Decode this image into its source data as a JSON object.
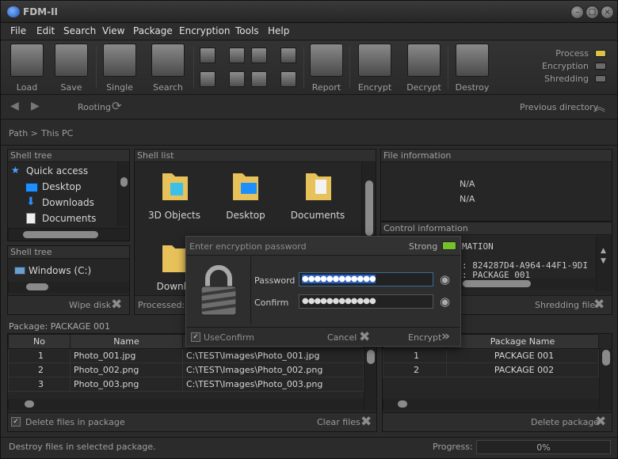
{
  "window": {
    "title": "FDM-II"
  },
  "menu": [
    "File",
    "Edit",
    "Search",
    "View",
    "Package",
    "Encryption",
    "Tools",
    "Help"
  ],
  "toolbar": {
    "buttons": [
      "Load",
      "Save",
      "Single",
      "Search",
      "Report",
      "Encrypt",
      "Decrypt",
      "Destroy"
    ],
    "indicators": [
      {
        "label": "Process",
        "color": "#d9c34a"
      },
      {
        "label": "Encryption",
        "color": "#6a6a6a"
      },
      {
        "label": "Shredding",
        "color": "#6a6a6a"
      }
    ]
  },
  "nav": {
    "rooting": "Rooting",
    "previous": "Previous directory"
  },
  "path": {
    "label": "Path >",
    "value": "This PC"
  },
  "shell_tree": {
    "header": "Shell tree",
    "items": [
      "Quick access",
      "Desktop",
      "Downloads",
      "Documents"
    ]
  },
  "drive_tree": {
    "header": "Shell tree",
    "items": [
      "Windows (C:)"
    ],
    "footer": "Wipe disk"
  },
  "shell_list": {
    "header": "Shell list",
    "items": [
      "3D Objects",
      "Desktop",
      "Documents",
      "Downlo"
    ],
    "footer": "Processed: 0"
  },
  "file_info": {
    "header": "File information",
    "lines": [
      "N/A",
      "N/A"
    ]
  },
  "control_info": {
    "header": "Control information",
    "lines": [
      "MATION",
      ": 824287D4-A964-44F1-9DI",
      ": PACKAGE 001"
    ],
    "footer": "Shredding file"
  },
  "dialog": {
    "title": "Enter encryption password",
    "strength": "Strong",
    "password_label": "Password",
    "password_value": "●●●●●●●●●●●●",
    "confirm_label": "Confirm",
    "confirm_value": "●●●●●●●●●●●●",
    "use_confirm": "UseConfirm",
    "cancel": "Cancel",
    "encrypt": "Encrypt"
  },
  "package_files": {
    "title": "Package: PACKAGE 001",
    "columns": [
      "No",
      "Name",
      "Path"
    ],
    "rows": [
      [
        "1",
        "Photo_001.jpg",
        "C:\\TEST\\Images\\Photo_001.jpg"
      ],
      [
        "2",
        "Photo_002.png",
        "C:\\TEST\\Images\\Photo_002.png"
      ],
      [
        "3",
        "Photo_003.png",
        "C:\\TEST\\Images\\Photo_003.png"
      ]
    ],
    "delete_files": "Delete files in package",
    "clear": "Clear files"
  },
  "packages": {
    "columns": [
      "No",
      "Package Name"
    ],
    "rows": [
      [
        "1",
        "PACKAGE 001"
      ],
      [
        "2",
        "PACKAGE 002"
      ]
    ],
    "delete": "Delete package"
  },
  "status": {
    "message": "Destroy files in selected package.",
    "progress_label": "Progress:",
    "progress_value": "0%"
  }
}
